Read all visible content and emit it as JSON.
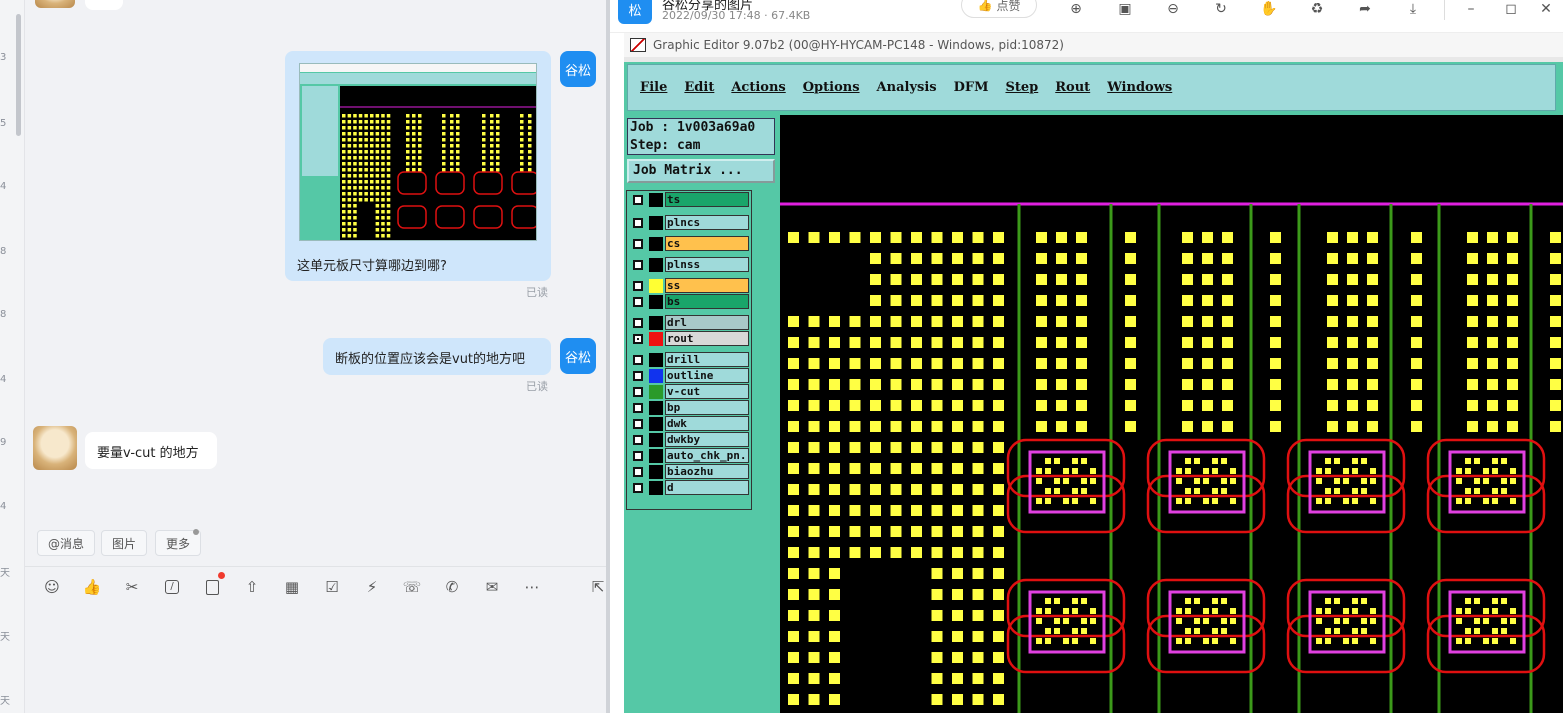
{
  "left_strip": {
    "numbers": [
      "3",
      "5",
      "4",
      "8",
      "8",
      "4",
      "9",
      "4",
      "天",
      "天",
      "天"
    ]
  },
  "chat": {
    "messages": [
      {
        "sender": "谷松",
        "type": "image",
        "caption": "这单元板尺寸算哪边到哪?",
        "status": "已读"
      },
      {
        "sender": "谷松",
        "type": "text",
        "text": "断板的位置应该会是vut的地方吧",
        "status": "已读"
      },
      {
        "sender": "other",
        "type": "text",
        "text": "要量v-cut 的地方"
      }
    ],
    "quick_actions": [
      "@消息",
      "图片",
      "更多"
    ],
    "toolbar_icons": [
      "emoji-icon",
      "thumbs-up-icon",
      "scissors-icon",
      "slash-icon",
      "note-add-icon",
      "upload-icon",
      "calendar-icon",
      "checkbox-icon",
      "lightning-icon",
      "headset-icon",
      "phone-icon",
      "mail-icon",
      "more-icon",
      "expand-icon"
    ]
  },
  "viewer": {
    "logo_text": "松",
    "title": "谷松分享的图片",
    "meta": "2022/09/30 17:48 · 67.4KB",
    "like_label": "点赞",
    "toolbar_icons": [
      "zoom-in-icon",
      "fit-icon",
      "zoom-out-icon",
      "rotate-icon",
      "hand-icon",
      "share-icon",
      "forward-icon",
      "download-icon"
    ],
    "window_controls": [
      "minimize-icon",
      "maximize-icon",
      "close-icon"
    ]
  },
  "graphic_editor": {
    "window_title": "Graphic Editor 9.07b2 (00@HY-HYCAM-PC148 - Windows, pid:10872)",
    "menu": [
      "File",
      "Edit",
      "Actions",
      "Options",
      "Analysis",
      "DFM",
      "Step",
      "Rout",
      "Windows"
    ],
    "job_line": "Job : 1v003a69a0",
    "step_line": "Step: cam",
    "job_matrix_label": "Job Matrix ...",
    "layers": [
      {
        "name": "ts",
        "color": "#1aa56a",
        "swatch": "#000000"
      },
      {
        "name": "plncs",
        "color": "#9fdada",
        "swatch": "#000000"
      },
      {
        "name": "cs",
        "color": "#ffc14d",
        "swatch": "#000000"
      },
      {
        "name": "plnss",
        "color": "#9fdada",
        "swatch": "#000000"
      },
      {
        "name": "ss",
        "color": "#ffc14d",
        "swatch": "#ffff33"
      },
      {
        "name": "bs",
        "color": "#1aa56a",
        "swatch": "#000000"
      },
      {
        "name": "drl",
        "color": "#a8c8c8",
        "swatch": "#000000"
      },
      {
        "name": "rout",
        "color": "#d8d8d8",
        "swatch": "#ee1111"
      },
      {
        "name": "drill",
        "color": "#9fdada",
        "swatch": "#000000"
      },
      {
        "name": "outline",
        "color": "#9fdada",
        "swatch": "#1133ee"
      },
      {
        "name": "v-cut",
        "color": "#9fdada",
        "swatch": "#2a9a2a"
      },
      {
        "name": "bp",
        "color": "#9fdada",
        "swatch": "#000000"
      },
      {
        "name": "dwk",
        "color": "#9fdada",
        "swatch": "#000000"
      },
      {
        "name": "dwkby",
        "color": "#9fdada",
        "swatch": "#000000"
      },
      {
        "name": "auto_chk_pn.",
        "color": "#9fdada",
        "swatch": "#000000"
      },
      {
        "name": "biaozhu",
        "color": "#9fdada",
        "swatch": "#000000"
      },
      {
        "name": "d",
        "color": "#9fdada",
        "swatch": "#000000"
      }
    ]
  }
}
